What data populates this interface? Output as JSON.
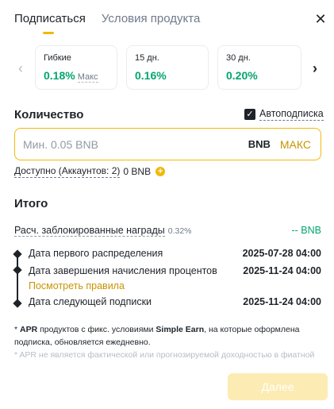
{
  "tabs": [
    {
      "label": "Подписаться",
      "active": true
    },
    {
      "label": "Условия продукта",
      "active": false
    }
  ],
  "durations": [
    {
      "term": "Гибкие",
      "apr": "0.18%",
      "tag": "Макс"
    },
    {
      "term": "15 дн.",
      "apr": "0.16%"
    },
    {
      "term": "30 дн.",
      "apr": "0.20%"
    }
  ],
  "amount_section": {
    "title": "Количество",
    "auto_subscribe_label": "Автоподписка",
    "auto_subscribe_checked": true,
    "input_placeholder": "Мин. 0.05 BNB",
    "input_value": "",
    "asset": "BNB",
    "max_label": "МАКС",
    "available_label": "Доступно (Аккаунтов: 2)",
    "available_value": "0 BNB"
  },
  "summary": {
    "title": "Итого",
    "est_rewards_label": "Расч. заблокированные награды",
    "est_rewards_pct": "0.32%",
    "est_rewards_value": "-- BNB",
    "timeline": [
      {
        "label": "Дата первого распределения",
        "value": "2025-07-28 04:00"
      },
      {
        "label": "Дата завершения начисления процентов",
        "value": "2025-11-24 04:00"
      },
      {
        "label": "Дата следующей подписки",
        "value": "2025-11-24 04:00"
      }
    ],
    "rules_link": "Посмотреть правила"
  },
  "notes": {
    "line1_prefix": "* ",
    "apr": "APR",
    "line1_mid": " продуктов с фикс. условиями ",
    "simple_earn": "Simple Earn",
    "line1_suffix": ", на которые оформлена подписка, обновляется ежедневно.",
    "line2": "* APR не является фактической или прогнозируемой доходностью в фиатной"
  },
  "next_button": "Далее",
  "colors": {
    "accent": "#f0b90b",
    "positive": "#03a66d",
    "link": "#c99400"
  }
}
